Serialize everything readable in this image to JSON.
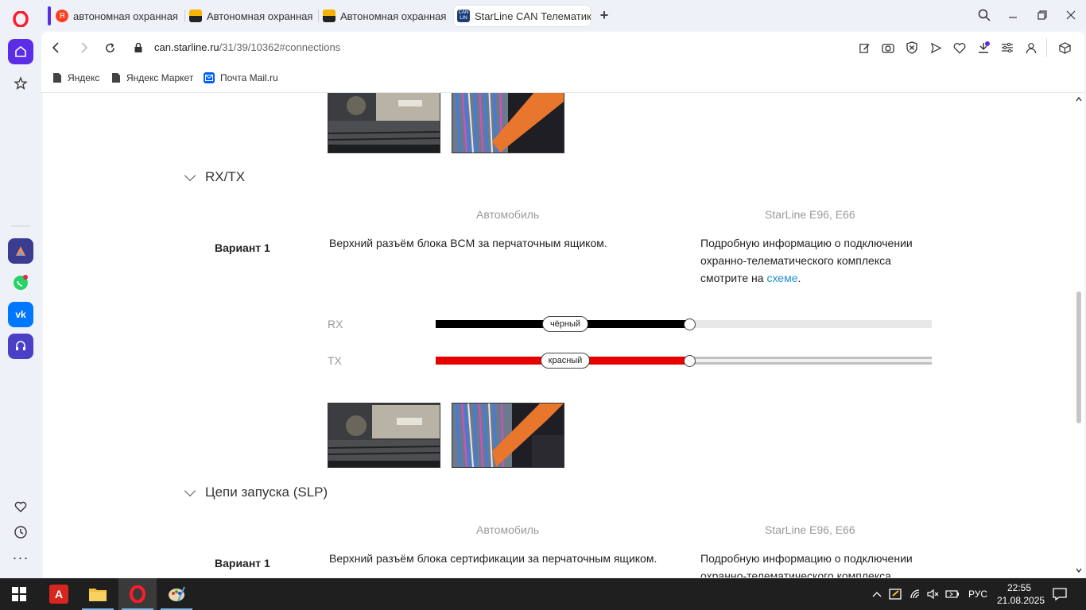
{
  "browser": {
    "tabs": [
      {
        "label": "автономная охранная авт",
        "favicon_color": "#fc3f1d"
      },
      {
        "label": "Автономная охранная авт",
        "favicon_color": "#f5b400"
      },
      {
        "label": "Автономная охранная си",
        "favicon_color": "#f5b400"
      },
      {
        "label": "StarLine CAN Телематика",
        "favicon_color": "#1c3f7a",
        "active": true
      }
    ],
    "address": {
      "domain": "can.starline.ru",
      "path": "/31/39/10362#connections"
    },
    "bookmarks": [
      {
        "label": "Яндекс"
      },
      {
        "label": "Яндекс Маркет"
      },
      {
        "label": "Почта Mail.ru"
      }
    ]
  },
  "content": {
    "rxtx": {
      "title": "RX/TX",
      "col_car": "Автомобиль",
      "col_starline": "StarLine E96, E66",
      "variant": "Вариант 1",
      "car_desc": "Верхний разъём блока BCM за перчаточным ящиком.",
      "starline_desc_1": "Подробную информацию о подключении",
      "starline_desc_2": "охранно-телематического комплекса",
      "starline_desc_3": "смотрите на ",
      "link": "схеме",
      "period": ".",
      "wires": [
        {
          "name": "RX",
          "color_label": "чёрный",
          "color": "#000000"
        },
        {
          "name": "TX",
          "color_label": "красный",
          "color": "#e60000"
        }
      ]
    },
    "slp": {
      "title": "Цепи запуска (SLP)",
      "col_car": "Автомобиль",
      "col_starline": "StarLine E96, E66",
      "variant": "Вариант 1",
      "car_desc": "Верхний разъём блока сертификации за перчаточным ящиком.",
      "starline_desc_1": "Подробную информацию о подключении",
      "starline_desc_2": "охранно-телематического комплекса"
    }
  },
  "taskbar": {
    "lang": "РУС",
    "time": "22:55",
    "date": "21.08.2025"
  }
}
